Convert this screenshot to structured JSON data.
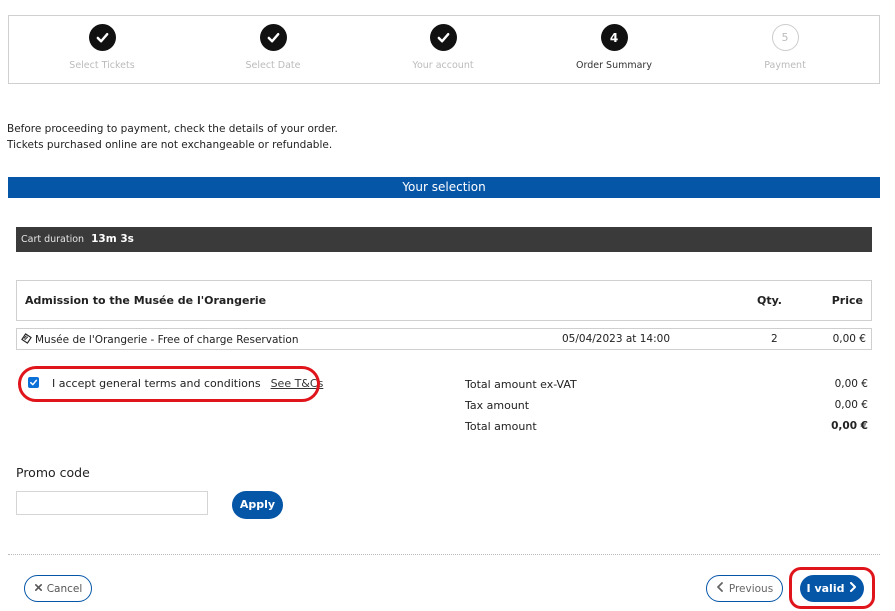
{
  "stepper": {
    "steps": [
      {
        "label": "Select Tickets",
        "state": "done"
      },
      {
        "label": "Select Date",
        "state": "done"
      },
      {
        "label": "Your account",
        "state": "done"
      },
      {
        "label": "Order Summary",
        "state": "current",
        "number": "4"
      },
      {
        "label": "Payment",
        "state": "todo",
        "number": "5"
      }
    ]
  },
  "intro": {
    "line1": "Before proceeding to payment, check the details of your order.",
    "line2": "Tickets purchased online are not exchangeable or refundable."
  },
  "selection": {
    "title": "Your selection"
  },
  "cart": {
    "label": "Cart duration",
    "duration": "13m 3s"
  },
  "table": {
    "header": {
      "name": "Admission to the Musée de l'Orangerie",
      "qty": "Qty.",
      "price": "Price"
    },
    "rows": [
      {
        "name": "Musée de l'Orangerie - Free of charge Reservation",
        "date": "05/04/2023 at 14:00",
        "qty": "2",
        "price": "0,00 €"
      }
    ]
  },
  "terms": {
    "label": "I accept general terms and conditions",
    "link": "See T&Cs",
    "checked": true
  },
  "totals": {
    "ex_vat_label": "Total amount ex-VAT",
    "ex_vat_value": "0,00 €",
    "tax_label": "Tax amount",
    "tax_value": "0,00 €",
    "total_label": "Total amount",
    "total_value": "0,00 €"
  },
  "promo": {
    "title": "Promo code",
    "value": "",
    "placeholder": "",
    "apply_label": "Apply"
  },
  "buttons": {
    "cancel": "Cancel",
    "previous": "Previous",
    "next": "I valid"
  },
  "colors": {
    "brand": "#0656a8",
    "highlight": "#e0151b",
    "cart_bar": "#3a3a3a"
  }
}
